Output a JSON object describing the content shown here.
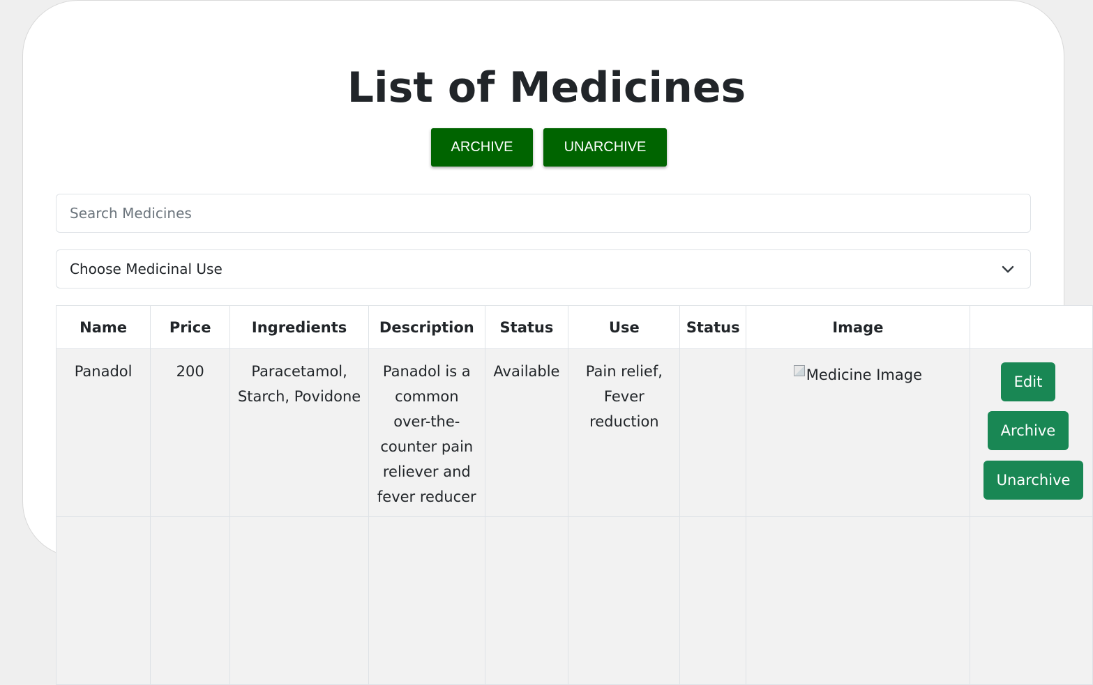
{
  "page": {
    "title": "List of Medicines"
  },
  "toolbar": {
    "archive_label": "ARCHIVE",
    "unarchive_label": "UNARCHIVE"
  },
  "search": {
    "placeholder": "Search Medicines",
    "value": ""
  },
  "use_filter": {
    "selected": "Choose Medicinal Use"
  },
  "table": {
    "headers": [
      "Name",
      "Price",
      "Ingredients",
      "Description",
      "Status",
      "Use",
      "Status",
      "Image",
      ""
    ],
    "rows": [
      {
        "name": "Panadol",
        "price": "200",
        "ingredients": "Paracetamol, Starch, Povidone",
        "description": "Panadol is a common over-the-counter pain reliever and fever reducer",
        "status": "Available",
        "use": "Pain relief, Fever reduction",
        "status2": "",
        "image_alt": "Medicine Image",
        "actions": {
          "edit": "Edit",
          "archive": "Archive",
          "unarchive": "Unarchive"
        }
      }
    ]
  },
  "colors": {
    "top_button": "#006400",
    "action_button": "#198754",
    "row_background": "#f2f2f2",
    "page_background": "#efefef"
  }
}
